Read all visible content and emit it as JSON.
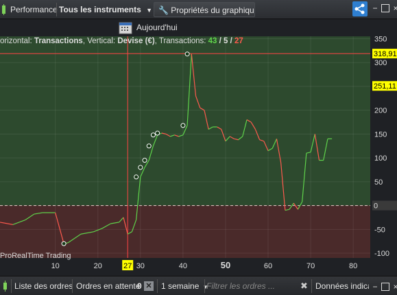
{
  "toolbar": {
    "performance_label": "Performance",
    "instruments_label": "Tous les instruments",
    "chart_props_label": "Propriétés du graphique...",
    "today_label": "Aujourd'hui"
  },
  "chart_header": {
    "prefix": "orizontal: ",
    "horizontal_value": "Transactions",
    "mid": ", Vertical: ",
    "vertical_value": "Devise (€)",
    "tx_label": ", Transactions: ",
    "tx_green": "43",
    "tx_sep1": " / ",
    "tx_white": "5",
    "tx_sep2": " / ",
    "tx_red": "27"
  },
  "watermark": "ProRealTime Trading",
  "price_tags": {
    "top": "318,91",
    "current": "251,11",
    "zero": "0"
  },
  "cursor_x_label": "27",
  "bottom": {
    "orders_label": "Liste des ordres",
    "pending_label": "Ordres en attente",
    "pending_count": "0",
    "period_label": "1 semaine",
    "filter_placeholder": "Filtrer les ordres ...",
    "data_label": "Données indica"
  },
  "colors": {
    "green": "#5fd34b",
    "red": "#ff5a4e",
    "bg_positive": "#2d4a2e",
    "bg_negative": "#4a2a2a",
    "cursor": "#ff4444",
    "price_tag": "#ffff00"
  },
  "chart_data": {
    "type": "line",
    "x": [
      -3,
      0,
      3,
      5,
      7,
      10,
      12,
      13,
      16,
      19,
      21,
      23,
      25,
      26,
      27,
      28,
      29,
      30,
      31,
      32,
      33,
      34,
      35,
      36,
      37,
      38,
      39,
      40,
      41,
      42,
      43,
      44,
      45,
      46,
      47,
      48,
      49,
      50,
      51,
      52,
      53,
      54,
      55,
      56,
      57,
      58,
      59,
      60,
      61,
      62,
      63,
      64,
      65,
      66,
      67,
      68,
      69,
      70,
      71,
      72,
      73,
      74,
      75
    ],
    "y": [
      -35,
      -40,
      -30,
      -18,
      -15,
      -15,
      -80,
      -78,
      -60,
      -55,
      -48,
      -38,
      -35,
      -25,
      -60,
      -55,
      -30,
      60,
      80,
      95,
      125,
      148,
      152,
      150,
      145,
      148,
      145,
      148,
      168,
      318,
      230,
      205,
      200,
      160,
      165,
      165,
      160,
      135,
      145,
      140,
      138,
      145,
      180,
      175,
      160,
      138,
      135,
      115,
      120,
      140,
      90,
      -10,
      -8,
      5,
      -8,
      8,
      110,
      112,
      150,
      95,
      95,
      140,
      140,
      225,
      251
    ],
    "xlim": [
      -3,
      84
    ],
    "ylim": [
      -110,
      355
    ],
    "xticks": [
      10,
      20,
      30,
      40,
      50,
      60,
      70,
      80
    ],
    "yticks": [
      -100,
      -50,
      0,
      50,
      100,
      150,
      200,
      250,
      300,
      350
    ],
    "bold_xtick": 50,
    "cursor_x": 27,
    "hline_top": 318.91,
    "markers": [
      [
        12,
        -80
      ],
      [
        29,
        60
      ],
      [
        30,
        80
      ],
      [
        31,
        95
      ],
      [
        32,
        125
      ],
      [
        33,
        148
      ],
      [
        34,
        152
      ],
      [
        40,
        168
      ],
      [
        41,
        318
      ]
    ]
  }
}
